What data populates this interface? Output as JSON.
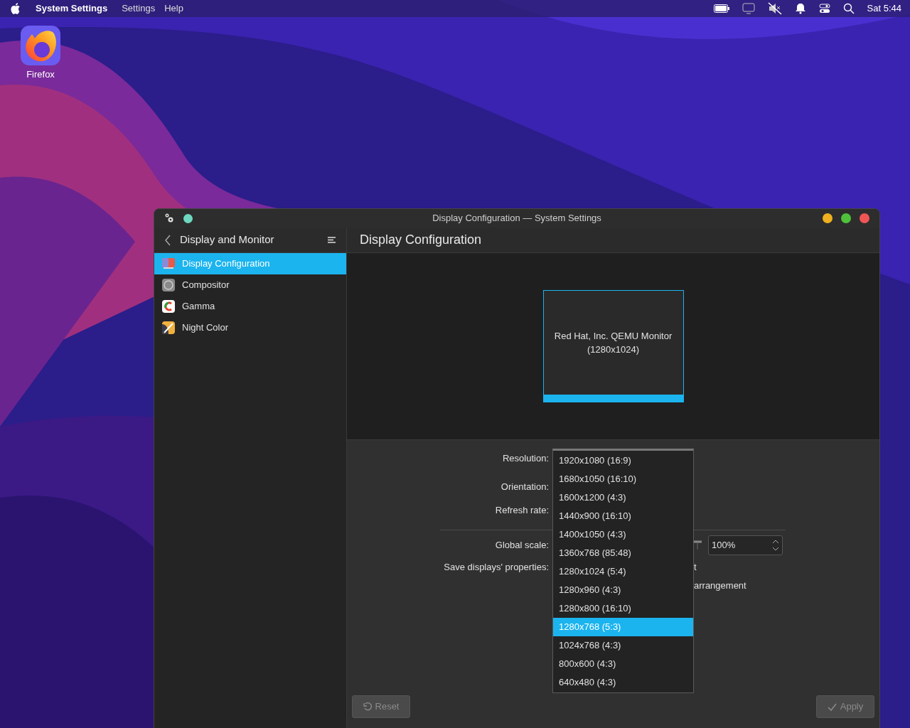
{
  "menu_bar": {
    "app": "System Settings",
    "menus": [
      "Settings",
      "Help"
    ],
    "clock": "Sat 5:44"
  },
  "desktop_icons": [
    {
      "label": "Firefox"
    }
  ],
  "window": {
    "title": "Display Configuration — System Settings"
  },
  "sidebar": {
    "title": "Display and Monitor",
    "items": [
      {
        "label": "Display Configuration",
        "selected": true,
        "kind": "display"
      },
      {
        "label": "Compositor",
        "selected": false,
        "kind": "compositor"
      },
      {
        "label": "Gamma",
        "selected": false,
        "kind": "gamma"
      },
      {
        "label": "Night Color",
        "selected": false,
        "kind": "night"
      }
    ]
  },
  "page": {
    "title": "Display Configuration"
  },
  "monitor": {
    "name": "Red Hat, Inc. QEMU Monitor",
    "resolution": "(1280x1024)",
    "selected": true
  },
  "form": {
    "rows": [
      {
        "label": "Resolution:",
        "kind": "plain",
        "separator_before": false
      },
      {
        "label": "Orientation:",
        "kind": "plain",
        "separator_before": false
      },
      {
        "label": "Refresh rate:",
        "kind": "plain",
        "separator_before": false
      },
      {
        "label": "Global scale:",
        "kind": "scale",
        "value": "100%",
        "separator_before": true
      },
      {
        "label": "Save displays' properties:",
        "kind": "option",
        "option": "t",
        "separator_before": false
      },
      {
        "kind": "option",
        "option": "arrangement",
        "separator_before": false
      }
    ]
  },
  "resolution_menu": {
    "items": [
      {
        "label": "1920x1080 (16:9)",
        "selected": false
      },
      {
        "label": "1680x1050 (16:10)",
        "selected": false
      },
      {
        "label": "1600x1200 (4:3)",
        "selected": false
      },
      {
        "label": "1440x900 (16:10)",
        "selected": false
      },
      {
        "label": "1400x1050 (4:3)",
        "selected": false
      },
      {
        "label": "1360x768 (85:48)",
        "selected": false
      },
      {
        "label": "1280x1024 (5:4)",
        "selected": false
      },
      {
        "label": "1280x960 (4:3)",
        "selected": false
      },
      {
        "label": "1280x800 (16:10)",
        "selected": false
      },
      {
        "label": "1280x768 (5:3)",
        "selected": true
      },
      {
        "label": "1024x768 (4:3)",
        "selected": false
      },
      {
        "label": "800x600 (4:3)",
        "selected": false
      },
      {
        "label": "640x480 (4:3)",
        "selected": false
      }
    ]
  },
  "buttons": [
    {
      "label": "Reset",
      "kind": "reset",
      "disabled": true
    },
    {
      "label": "Apply",
      "kind": "apply",
      "disabled": true
    }
  ]
}
